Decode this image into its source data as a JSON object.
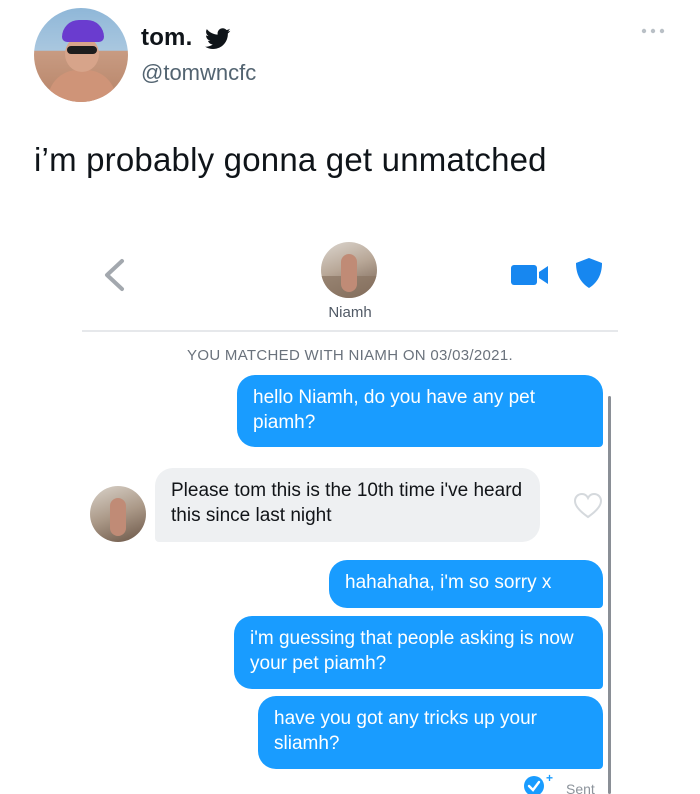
{
  "tweet": {
    "display_name": "tom.",
    "handle": "@tomwncfc",
    "text": "i’m probably gonna get unmatched",
    "icons": {
      "platform": "twitter-bird-icon",
      "more": "more-icon"
    }
  },
  "chat": {
    "match_name": "Niamh",
    "match_note": "YOU MATCHED WITH NIAMH ON 03/03/2021.",
    "messages": [
      {
        "side": "sent",
        "text": "hello Niamh, do you have any pet piamh?"
      },
      {
        "side": "received",
        "text": "Please tom this is the 10th time i've heard this since last night"
      },
      {
        "side": "sent",
        "text": "hahahaha, i'm so sorry x"
      },
      {
        "side": "sent",
        "text": "i'm guessing that people asking is now your pet piamh?"
      },
      {
        "side": "sent",
        "text": "have you got any tricks up your sliamh?"
      }
    ],
    "status": {
      "plus": "+",
      "label": "Sent"
    },
    "colors": {
      "sent_bubble": "#199cff",
      "received_bubble": "#eef0f2",
      "icon_blue": "#1787f0"
    }
  }
}
